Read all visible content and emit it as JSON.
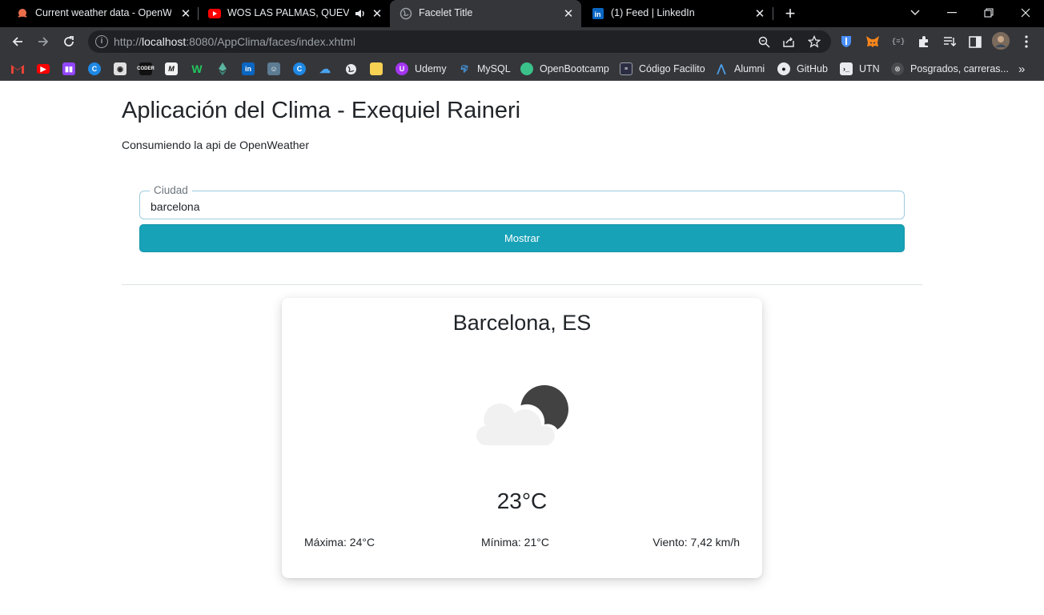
{
  "browser": {
    "tabs": [
      {
        "title": "Current weather data - OpenWea",
        "active": false,
        "icon": "openweather-icon"
      },
      {
        "title": "WOS LAS PALMAS, QUEVEDO",
        "active": false,
        "icon": "youtube-icon",
        "audio": true
      },
      {
        "title": "Facelet Title",
        "active": true,
        "icon": "globe-icon"
      },
      {
        "title": "(1) Feed | LinkedIn",
        "active": false,
        "icon": "linkedin-icon"
      }
    ],
    "address": {
      "scheme": "http://",
      "host": "localhost",
      "rest": ":8080/AppClima/faces/index.xhtml"
    },
    "bookmarks": {
      "udemy": "Udemy",
      "mysql": "MySQL",
      "openbootcamp": "OpenBootcamp",
      "codigo_facilito": "Código Facilito",
      "alumni": "Alumni",
      "github": "GitHub",
      "utn": "UTN",
      "posgrados": "Posgrados, carreras..."
    },
    "colors": {
      "tabbar": "#000000",
      "toolbar": "#35363a",
      "omnibox": "#202124"
    }
  },
  "app": {
    "title": "Aplicación del Clima - Exequiel Raineri",
    "subtitle": "Consumiendo la api de OpenWeather",
    "form": {
      "city_label": "Ciudad",
      "city_value": "barcelona",
      "submit_label": "Mostrar"
    },
    "weather": {
      "location": "Barcelona, ES",
      "condition_icon": "partly-cloudy-night-icon",
      "temperature": "23°C",
      "max": "Máxima: 24°C",
      "min": "Mínima: 21°C",
      "wind": "Viento: 7,42 km/h"
    },
    "colors": {
      "accent": "#17a2b8",
      "text": "#212529",
      "field_border": "#9fcbe0"
    }
  }
}
